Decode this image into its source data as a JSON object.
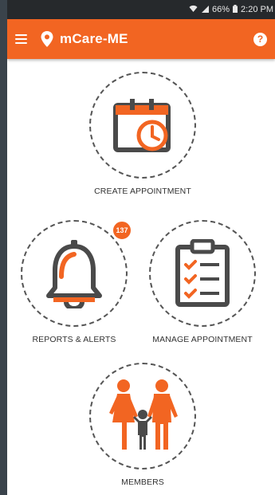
{
  "statusbar": {
    "battery": "66%",
    "time": "2:20 PM"
  },
  "appbar": {
    "title": "mCare-ME",
    "help": "?"
  },
  "tiles": [
    {
      "label": "CREATE APPOINTMENT"
    },
    {
      "label": "REPORTS & ALERTS",
      "badge": "137"
    },
    {
      "label": "MANAGE APPOINTMENT"
    },
    {
      "label": "MEMBERS"
    }
  ],
  "colors": {
    "accent": "#f26522",
    "icon_dark": "#4a4a4a",
    "ring": "#555555"
  }
}
